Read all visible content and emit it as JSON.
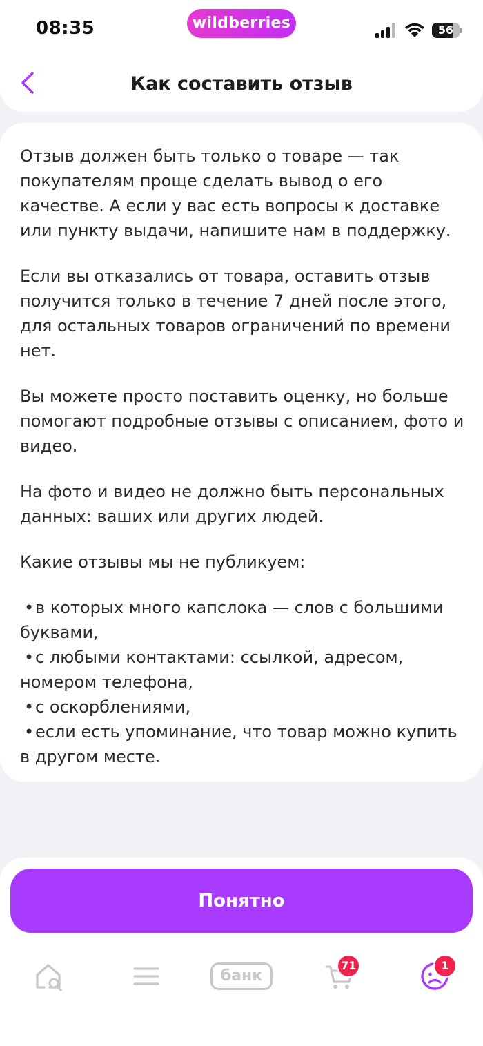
{
  "status_bar": {
    "time": "08:35",
    "brand": "wildberries",
    "battery": "56"
  },
  "header": {
    "title": "Как составить отзыв"
  },
  "content": {
    "paragraphs": [
      "Отзыв должен быть только о товаре — так покупателям проще сделать вывод о его качестве. А если у вас есть вопросы к доставке или пункту выдачи, напишите нам в поддержку.",
      "Если вы отказались от товара, оставить отзыв получится только в течение 7 дней после этого, для остальных товаров ограничений по времени нет.",
      "Вы можете просто поставить оценку, но больше помогают подробные отзывы с описанием, фото и видео.",
      "На фото и видео не должно быть персональных данных: ваших или других людей.",
      "Какие отзывы мы не публикуем:"
    ],
    "bullet_char": "•",
    "bullets": [
      "в которых много капслока — слов с большими буквами,",
      "с любыми контактами: ссылкой, адресом, номером телефона,",
      "с оскорблениями,",
      "если есть упоминание, что товар можно купить в другом месте."
    ]
  },
  "actions": {
    "ok_label": "Понятно"
  },
  "tab_bar": {
    "bank_label": "банк",
    "cart_count": "71",
    "profile_count": "1"
  },
  "colors": {
    "accent": "#a73afd",
    "brand_gradient_start": "#e43bd0",
    "brand_gradient_end": "#c32ef2",
    "badge": "#f2224f",
    "inactive_icon": "#c6c6cc"
  },
  "icons": {
    "back": "chevron-left-icon",
    "home": "home-search-icon",
    "catalog": "menu-lines-icon",
    "cart": "cart-icon",
    "profile": "sad-face-profile-icon"
  }
}
